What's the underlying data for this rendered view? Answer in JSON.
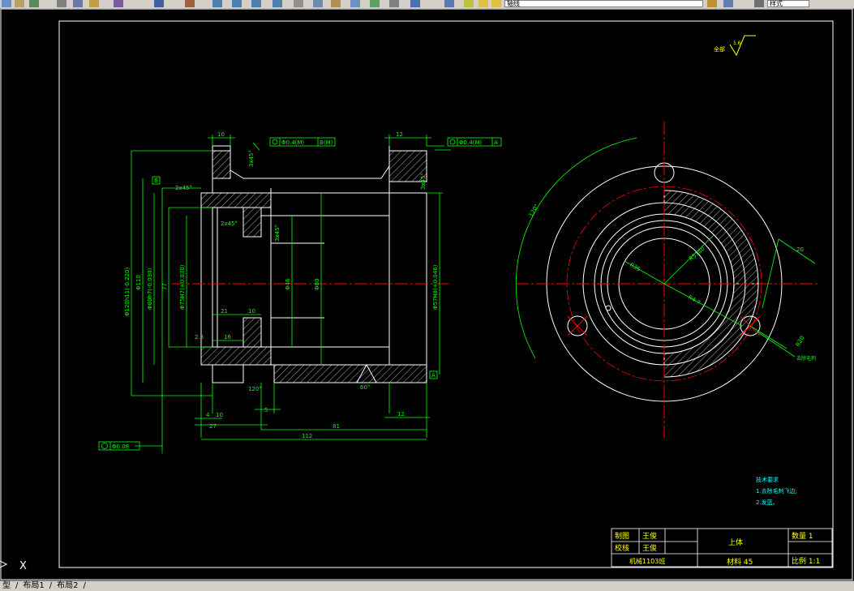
{
  "toolbar": {
    "layer_combo_text": "轴线",
    "right_combo_text": "样式"
  },
  "colors": {
    "background": "#000000",
    "outline": "#ffffff",
    "dimension": "#00ff00",
    "centerline": "#ff0000",
    "text_yellow": "#ffff00"
  },
  "drawing": {
    "roughness_label": "全部",
    "roughness_value": "1.6",
    "gdt_top_left": [
      "Φ0.4(M)",
      "B(M)"
    ],
    "gdt_top_right": [
      "Φ0.4(M)",
      "A"
    ],
    "gdt_bottom": "Φ0.08",
    "datum_B": "B",
    "datum_A": "A",
    "dims_top": {
      "left": "10",
      "right": "12"
    },
    "dims_chamfer": [
      "2x45°",
      "3x45°",
      "3x45°",
      "2x45°",
      "3x45°"
    ],
    "dims_vertical": [
      "Φ120h11(-0.220)",
      "Φ110",
      "Φ80h7(-0.030)",
      "Φ75H7(+0.030)",
      "77",
      "Φ46",
      "Φ80",
      "Φ57H8(+0.046)"
    ],
    "dims_internal": [
      "21",
      "10",
      "2.3",
      "16"
    ],
    "dims_bottom": [
      "4",
      "10",
      "27",
      "5",
      "81",
      "12",
      "112"
    ],
    "dims_angle": [
      "120°",
      "60°"
    ],
    "side_view_dims": [
      "120°",
      "R5180",
      "R35",
      "R4.7",
      "R20",
      "20"
    ],
    "side_view_note": "去除毛刺",
    "tech_requirements": {
      "title": "技术要求",
      "items": [
        "1.去除毛刺飞边;",
        "2.发蓝。"
      ]
    }
  },
  "title_block": {
    "drawn_label": "制图",
    "drawn_by": "王俊",
    "checked_label": "校核",
    "checked_by": "王俊",
    "class_label": "机械1103班",
    "part_name": "上体",
    "material": "材料 45",
    "quantity": "数量 1",
    "scale": "比例 1:1"
  },
  "command_prompt": "X",
  "layout_tabs": [
    "型",
    "布局1",
    "布局2"
  ]
}
